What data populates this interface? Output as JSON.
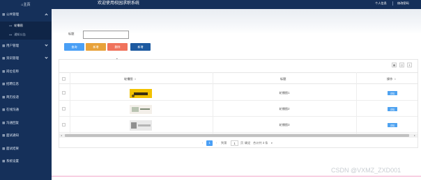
{
  "sidebar": {
    "home": "⌂主页",
    "items": [
      {
        "label": "公共管理",
        "icon": "grid-icon",
        "expanded": true
      },
      {
        "label": "用户管理",
        "icon": "grid-icon",
        "expanded": false
      },
      {
        "label": "资讯管理",
        "icon": "grid-icon",
        "expanded": false
      },
      {
        "label": "岗位名称",
        "icon": "grid-icon"
      },
      {
        "label": "招聘信息",
        "icon": "grid-icon"
      },
      {
        "label": "简历投递",
        "icon": "grid-icon"
      },
      {
        "label": "在线沟通",
        "icon": "grid-icon"
      },
      {
        "label": "沟通回复",
        "icon": "grid-icon"
      },
      {
        "label": "面试通知",
        "icon": "grid-icon"
      },
      {
        "label": "面试结果",
        "icon": "grid-icon"
      },
      {
        "label": "系统设置",
        "icon": "grid-icon"
      }
    ],
    "subitems": [
      {
        "label": "轮播图",
        "active": true
      },
      {
        "label": "通知公告",
        "active": false
      }
    ]
  },
  "header": {
    "title": "欢迎使用校园求职系统",
    "profile": "个人信息",
    "password": "修改密码"
  },
  "search": {
    "label": "标题",
    "value": "",
    "buttons": [
      {
        "label": "查询",
        "color": "#4a9ff5"
      },
      {
        "label": "新增",
        "color": "#e8a23a"
      },
      {
        "label": "删除",
        "color": "#f0735c"
      },
      {
        "label": "新增",
        "color": "#1d5aa0"
      }
    ]
  },
  "table": {
    "columns": [
      "轮播图",
      "标题",
      "操作"
    ],
    "rows": [
      {
        "title": "轮播图1",
        "action": "详情",
        "thumb": "thumb-1"
      },
      {
        "title": "轮播图2",
        "action": "详情",
        "thumb": "thumb-2"
      },
      {
        "title": "轮播图3",
        "action": "详情",
        "thumb": "thumb-3"
      }
    ],
    "toolbar_icons": [
      "grid-icon",
      "print-icon",
      "export-icon"
    ]
  },
  "pagination": {
    "prev": "‹",
    "current": "1",
    "next": "›",
    "goto_label": "到第",
    "goto_value": "1",
    "page_unit": "页",
    "confirm": "确定",
    "total": "合计共 3 条"
  },
  "watermark": "CSDN @VXMZ_ZXD001",
  "colors": {
    "sidebar_bg": "#15305a",
    "accent_blue": "#4a9ff5",
    "bottom_line": "#f2a6c8"
  }
}
